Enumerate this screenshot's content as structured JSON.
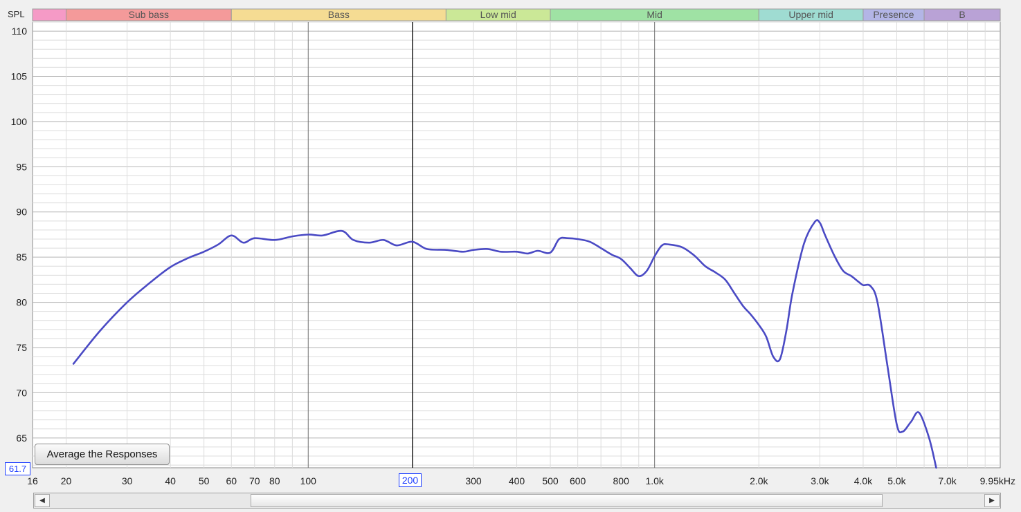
{
  "chart_data": {
    "type": "line",
    "ylabel": "SPL",
    "x_unit": "Hz",
    "xscale": "log",
    "xlim": [
      16,
      9950
    ],
    "ylim": [
      61.7,
      111
    ],
    "grid": true,
    "y_ticks": [
      110,
      105,
      100,
      95,
      90,
      85,
      80,
      75,
      70,
      65
    ],
    "x_ticks": [
      {
        "value": 16,
        "label": "16"
      },
      {
        "value": 20,
        "label": "20"
      },
      {
        "value": 30,
        "label": "30"
      },
      {
        "value": 40,
        "label": "40"
      },
      {
        "value": 50,
        "label": "50"
      },
      {
        "value": 60,
        "label": "60"
      },
      {
        "value": 70,
        "label": "70"
      },
      {
        "value": 80,
        "label": "80"
      },
      {
        "value": 100,
        "label": "100"
      },
      {
        "value": 300,
        "label": "300"
      },
      {
        "value": 400,
        "label": "400"
      },
      {
        "value": 500,
        "label": "500"
      },
      {
        "value": 600,
        "label": "600"
      },
      {
        "value": 800,
        "label": "800"
      },
      {
        "value": 1000,
        "label": "1.0k"
      },
      {
        "value": 2000,
        "label": "2.0k"
      },
      {
        "value": 3000,
        "label": "3.0k"
      },
      {
        "value": 4000,
        "label": "4.0k"
      },
      {
        "value": 5000,
        "label": "5.0k"
      },
      {
        "value": 7000,
        "label": "7.0k"
      },
      {
        "value": 9950,
        "label": "9.95kHz"
      }
    ],
    "bands": [
      {
        "label": "",
        "from": 16,
        "to": 20,
        "color": "#f59ac6"
      },
      {
        "label": "Sub bass",
        "from": 20,
        "to": 60,
        "color": "#f49a9a"
      },
      {
        "label": "Bass",
        "from": 60,
        "to": 250,
        "color": "#f5dc93"
      },
      {
        "label": "Low mid",
        "from": 250,
        "to": 500,
        "color": "#cbe897"
      },
      {
        "label": "Mid",
        "from": 500,
        "to": 2000,
        "color": "#9fe2a4"
      },
      {
        "label": "Upper mid",
        "from": 2000,
        "to": 4000,
        "color": "#9fdcd2"
      },
      {
        "label": "Presence",
        "from": 4000,
        "to": 6000,
        "color": "#b3b5e6"
      },
      {
        "label": "B",
        "from": 6000,
        "to": 9950,
        "color": "#b9a2d6"
      }
    ],
    "series": [
      {
        "color": "#4a4ac4",
        "x": [
          21,
          25,
          30,
          35,
          40,
          45,
          50,
          55,
          60,
          65,
          70,
          80,
          90,
          100,
          110,
          125,
          135,
          150,
          165,
          180,
          200,
          220,
          250,
          280,
          300,
          330,
          360,
          400,
          430,
          460,
          500,
          530,
          560,
          600,
          650,
          700,
          750,
          800,
          850,
          900,
          950,
          1000,
          1050,
          1100,
          1200,
          1300,
          1400,
          1500,
          1600,
          1700,
          1800,
          1900,
          2000,
          2100,
          2200,
          2300,
          2400,
          2500,
          2700,
          2900,
          3000,
          3100,
          3300,
          3500,
          3700,
          3900,
          4000,
          4200,
          4400,
          4700,
          5000,
          5200,
          5500,
          5800,
          6200,
          6500
        ],
        "y": [
          73.2,
          76.8,
          80.0,
          82.2,
          83.9,
          84.9,
          85.6,
          86.4,
          87.4,
          86.6,
          87.1,
          86.9,
          87.3,
          87.5,
          87.4,
          87.9,
          86.9,
          86.6,
          86.9,
          86.3,
          86.7,
          85.9,
          85.8,
          85.6,
          85.8,
          85.9,
          85.6,
          85.6,
          85.4,
          85.7,
          85.5,
          87.0,
          87.1,
          87.0,
          86.7,
          86.0,
          85.3,
          84.8,
          83.8,
          82.9,
          83.5,
          85.1,
          86.3,
          86.4,
          86.1,
          85.2,
          84.0,
          83.3,
          82.5,
          81.0,
          79.6,
          78.6,
          77.5,
          76.2,
          74.0,
          73.7,
          76.8,
          81.0,
          86.5,
          88.9,
          88.8,
          87.5,
          85.2,
          83.5,
          82.9,
          82.2,
          81.9,
          81.8,
          80.0,
          73.0,
          66.5,
          65.7,
          66.8,
          67.8,
          65.0,
          61.7
        ]
      }
    ],
    "cursor_x": 200,
    "cursor_x_label": "200",
    "cursor_y_label": "61.7"
  },
  "ui": {
    "average_button": "Average the Responses",
    "scroll_left": "◀",
    "scroll_right": "▶"
  },
  "colors": {
    "background": "#f0f0f0",
    "plot_background": "#ffffff",
    "grid_minor": "#dcdcdc",
    "grid_major": "#b4b4b4",
    "cursor": "#000000",
    "readout": "#1b3cff"
  }
}
